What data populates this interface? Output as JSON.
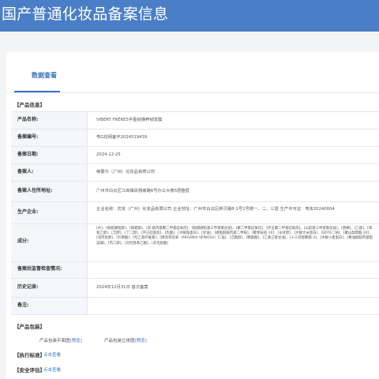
{
  "header": {
    "title": "国产普通化妆品备案信息"
  },
  "tabs": {
    "active_label": "数据查看"
  },
  "sections": {
    "product_info": "【产品信息】",
    "packaging": "【产品包装】",
    "standard": "【执行标准】",
    "safety": "【安全评估】"
  },
  "fields": [
    {
      "label": "产品名称:",
      "value": "VIBERT FRÈRES丰盈韧弹养韧发膜"
    },
    {
      "label": "备案编号:",
      "value": "粤G妆网备字2024519439"
    },
    {
      "label": "备案日期:",
      "value": "2024-12-25"
    },
    {
      "label": "备案人:",
      "value": "维蕾尔（广州）化妆品有限公司"
    },
    {
      "label": "备案人住所地址:",
      "value": "广州市白云区江高镇凤翔南路6号办公大楼5层整层"
    },
    {
      "label": "生产企业:",
      "value": "企业名称：优妆（广州）化妆品有限公司 企业地址：广州市白云区新贝路8-1号1号楼一、二、三层 生产许可证：粤妆20240004"
    },
    {
      "label": "成分:",
      "value": "[水]、[鲸蜡硬脂醇]、[鲸蜡醇]、[双-氨丙基聚二甲基硅氧烷]、[鲸蜡硬脂基三甲基氯化铵]、[聚二甲基硅氧烷]、[环五聚二甲基硅氧烷]、[山嵛基三甲基氯化铵]、[香精]、[乙醇]、[苯氧乙醇]、[泛醇]、[丁二醇]、[环己硅氧烷]、[乳酸]、[水解角蛋白]、[甘油]、[硬脂酰胺丙基二甲胺]、[聚季铵盐-10]、[辛甘醇]、[水解大米蛋白]、[EDTA二钠]、[聚山梨醇酯-20]、[双丙甘醇]、[柠檬酸]、[羟乙基纤维素]、[摩洛哥坚果（ARGANIA SPINOSA）仁油]、[泛酰醇]、[精氨酸]、[乙基己基甘油]、[十三烷醇聚醚-3]、[水解小麦蛋白]、[椰油酰胺丙基甜菜碱]、[丙二醇]、[对羟基苯乙酮]、[羊毛脂酸]"
    },
    {
      "label": "备案后监督检查情况:",
      "value": ""
    },
    {
      "label": "历史记录:",
      "value": "2024年12月31日 首次备案"
    },
    {
      "label": "备注:",
      "value": ""
    }
  ],
  "packaging": {
    "flat_label": "产品包装平面图",
    "solid_label": "产品包装立体图",
    "view_label": "[预览]"
  },
  "links": {
    "click_view": "点击查看"
  }
}
